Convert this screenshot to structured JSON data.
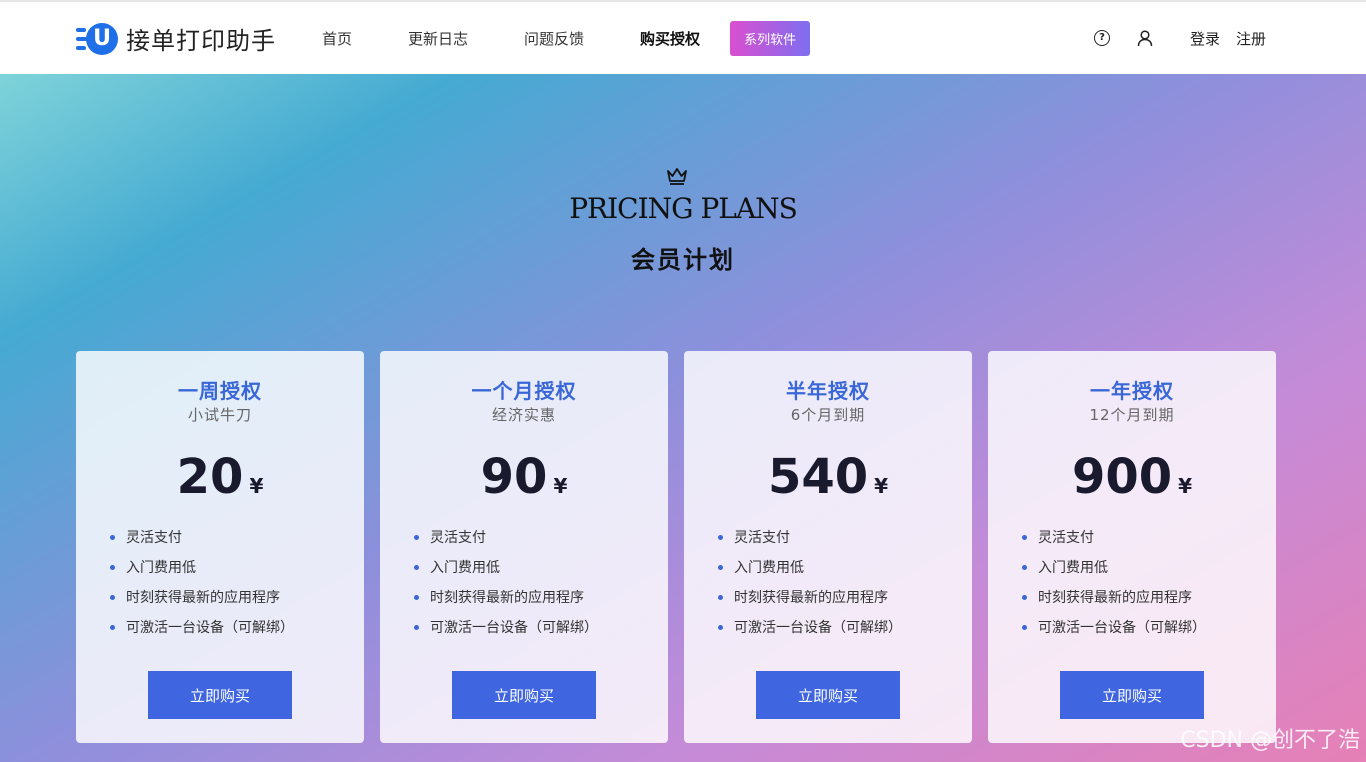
{
  "header": {
    "logo_mark": "U",
    "logo_text": "接单打印助手",
    "nav": [
      "首页",
      "更新日志",
      "问题反馈",
      "购买授权"
    ],
    "nav_active": "购买授权",
    "badge": "系列软件",
    "help_glyph": "?",
    "login": "登录",
    "register": "注册"
  },
  "hero": {
    "title": "PRICING PLANS",
    "subtitle": "会员计划"
  },
  "plans": [
    {
      "title": "一周授权",
      "subtitle": "小试牛刀",
      "price": "20",
      "currency": "¥",
      "features": [
        "灵活支付",
        "入门费用低",
        "时刻获得最新的应用程序",
        "可激活一台设备（可解绑）"
      ],
      "button": "立即购买"
    },
    {
      "title": "一个月授权",
      "subtitle": "经济实惠",
      "price": "90",
      "currency": "¥",
      "features": [
        "灵活支付",
        "入门费用低",
        "时刻获得最新的应用程序",
        "可激活一台设备（可解绑）"
      ],
      "button": "立即购买"
    },
    {
      "title": "半年授权",
      "subtitle": "6个月到期",
      "price": "540",
      "currency": "¥",
      "features": [
        "灵活支付",
        "入门费用低",
        "时刻获得最新的应用程序",
        "可激活一台设备（可解绑）"
      ],
      "button": "立即购买"
    },
    {
      "title": "一年授权",
      "subtitle": "12个月到期",
      "price": "900",
      "currency": "¥",
      "features": [
        "灵活支付",
        "入门费用低",
        "时刻获得最新的应用程序",
        "可激活一台设备（可解绑）"
      ],
      "button": "立即购买"
    }
  ],
  "watermark": "CSDN @创不了浩",
  "colors": {
    "accent": "#3f66e0",
    "title_blue": "#3a67d8",
    "badge_start": "#d94fd0",
    "badge_end": "#7f6ef0"
  }
}
